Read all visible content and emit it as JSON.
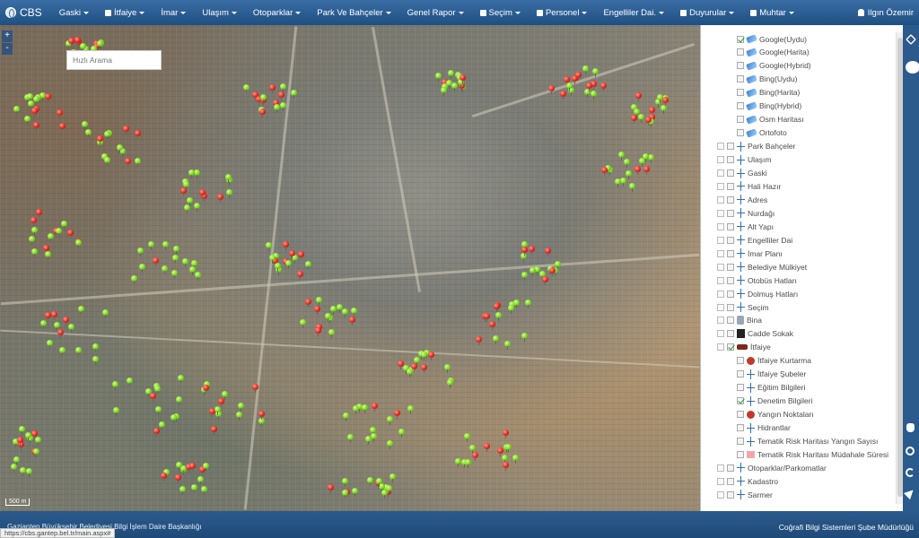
{
  "app": {
    "brand": "CBS"
  },
  "navbar": {
    "menu": [
      {
        "label": "Gaski"
      },
      {
        "label": "İtfaiye"
      },
      {
        "label": "İmar"
      },
      {
        "label": "Ulaşım"
      },
      {
        "label": "Otoparklar"
      },
      {
        "label": "Park Ve Bahçeler"
      },
      {
        "label": "Genel Rapor"
      },
      {
        "label": "Seçim"
      },
      {
        "label": "Personel"
      },
      {
        "label": "Engelliler Dai."
      },
      {
        "label": "Duyurular"
      },
      {
        "label": "Muhtar"
      }
    ],
    "user": "Ilgın Özemir"
  },
  "map": {
    "search_placeholder": "Hızlı Arama",
    "scale_label": "500 m",
    "zoom_in": "+",
    "zoom_out": "-"
  },
  "layers": [
    {
      "label": "Google(Uydu)",
      "checked": true,
      "icon": "satellite-icon"
    },
    {
      "label": "Google(Harita)",
      "checked": false,
      "icon": "satellite-icon"
    },
    {
      "label": "Google(Hybrid)",
      "checked": false,
      "icon": "satellite-icon"
    },
    {
      "label": "Bing(Uydu)",
      "checked": false,
      "icon": "satellite-icon"
    },
    {
      "label": "Bing(Harita)",
      "checked": false,
      "icon": "satellite-icon"
    },
    {
      "label": "Bing(Hybrid)",
      "checked": false,
      "icon": "satellite-icon"
    },
    {
      "label": "Osm Haritası",
      "checked": false,
      "icon": "satellite-icon"
    },
    {
      "label": "Ortofoto",
      "checked": false,
      "icon": "satellite-icon"
    },
    {
      "label": "Park Bahçeler",
      "checked": false,
      "icon": "network-icon",
      "group": true
    },
    {
      "label": "Ulaşım",
      "checked": false,
      "icon": "network-icon",
      "group": true
    },
    {
      "label": "Gaski",
      "checked": false,
      "icon": "network-icon",
      "group": true
    },
    {
      "label": "Hali Hazır",
      "checked": false,
      "icon": "network-icon",
      "group": true
    },
    {
      "label": "Adres",
      "checked": false,
      "icon": "network-icon",
      "group": true
    },
    {
      "label": "Nurdağı",
      "checked": false,
      "icon": "network-icon",
      "group": true
    },
    {
      "label": "Alt Yapı",
      "checked": false,
      "icon": "network-icon",
      "group": true
    },
    {
      "label": "Engelliler Dai",
      "checked": false,
      "icon": "network-icon",
      "group": true
    },
    {
      "label": "İmar Planı",
      "checked": false,
      "icon": "network-icon",
      "group": true
    },
    {
      "label": "Belediye Mülkiyet",
      "checked": false,
      "icon": "network-icon",
      "group": true
    },
    {
      "label": "Otobüs Hatları",
      "checked": false,
      "icon": "network-icon",
      "group": true
    },
    {
      "label": "Dolmuş Hatları",
      "checked": false,
      "icon": "network-icon",
      "group": true
    },
    {
      "label": "Seçim",
      "checked": false,
      "icon": "network-icon",
      "group": true
    },
    {
      "label": "Bina",
      "checked": false,
      "icon": "building-icon",
      "group": true
    },
    {
      "label": "Cadde Sokak",
      "checked": false,
      "icon": "street-icon",
      "group": true
    },
    {
      "label": "İtfaiye",
      "checked": true,
      "icon": "fire-truck-icon",
      "group": true
    },
    {
      "label": "İtfaiye Kurtarma",
      "checked": false,
      "icon": "rescue-icon"
    },
    {
      "label": "İtfaiye Şubeler",
      "checked": false,
      "icon": "network-icon"
    },
    {
      "label": "Eğitim Bilgileri",
      "checked": false,
      "icon": "network-icon"
    },
    {
      "label": "Denetim Bilgileri",
      "checked": true,
      "icon": "network-icon"
    },
    {
      "label": "Yangın Noktaları",
      "checked": false,
      "icon": "fire-point-icon"
    },
    {
      "label": "Hidrantlar",
      "checked": false,
      "icon": "network-icon"
    },
    {
      "label": "Tematik Risk Haritası Yangın Sayısı",
      "checked": false,
      "icon": "network-icon"
    },
    {
      "label": "Tematik Risk Haritası Müdahale Süresi",
      "checked": false,
      "icon": "legend-icon"
    },
    {
      "label": "Otoparklar/Parkomatlar",
      "checked": false,
      "icon": "network-icon",
      "group": true
    },
    {
      "label": "Kadastro",
      "checked": false,
      "icon": "network-icon",
      "group": true
    },
    {
      "label": "Sarmer",
      "checked": false,
      "icon": "network-icon",
      "group": true
    }
  ],
  "footer": {
    "left": "Gaziantep Büyükşehir Belediyesi Bilgi İşlem Daire Başkanlığı",
    "right": "Coğrafi Bilgi Sistemleri Şube Müdürlüğü",
    "status_url": "https://cbs.gantep.bel.tr/main.aspx#"
  },
  "colors": {
    "nav": "#2b5a8c",
    "pin_green": "#6fcf16",
    "pin_red": "#e21b12"
  }
}
